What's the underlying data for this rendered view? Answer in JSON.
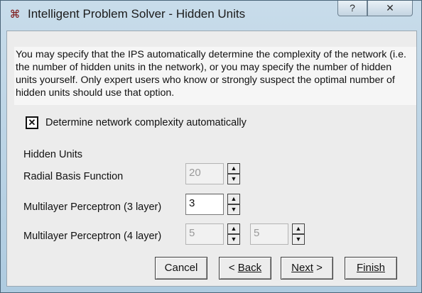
{
  "window": {
    "title": "Intelligent Problem Solver - Hidden Units",
    "help_label": "?",
    "close_label": "✕",
    "app_icon": "⌘"
  },
  "description": "You may specify that the IPS automatically determine the complexity of the network (i.e. the number of hidden units in the network), or you may specify the number of hidden units yourself. Only expert users who know or strongly suspect the optimal number of hidden units should use that option.",
  "auto_complexity": {
    "label": "Determine network complexity automatically",
    "checked": true,
    "mark": "✕"
  },
  "hidden_units": {
    "section_label": "Hidden Units",
    "rows": [
      {
        "label": "Radial Basis Function",
        "values": [
          "20"
        ],
        "enabled": false
      },
      {
        "label": "Multilayer Perceptron (3 layer)",
        "values": [
          "3"
        ],
        "enabled": true
      },
      {
        "label": "Multilayer Perceptron (4 layer)",
        "values": [
          "5",
          "5"
        ],
        "enabled": false
      }
    ]
  },
  "spinner": {
    "up": "▲",
    "down": "▼"
  },
  "buttons": {
    "cancel": "Cancel",
    "back_prefix": "< ",
    "back": "Back",
    "next": "Next",
    "next_suffix": " >",
    "finish": "Finish"
  }
}
